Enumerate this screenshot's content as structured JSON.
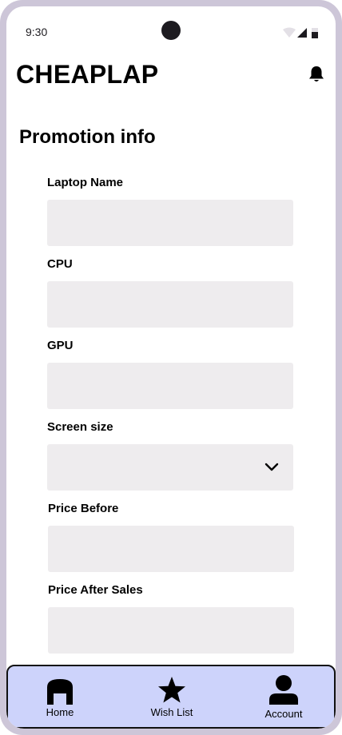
{
  "status_bar": {
    "time": "9:30"
  },
  "header": {
    "brand": "CHEAPLAP"
  },
  "page": {
    "title": "Promotion info"
  },
  "form": {
    "laptop_name_label": "Laptop Name",
    "cpu_label": "CPU",
    "gpu_label": "GPU",
    "screen_size_label": "Screen size",
    "price_before_label": "Price Before",
    "price_after_label": "Price After Sales"
  },
  "nav": {
    "items": [
      {
        "label": "Home",
        "icon": "home-icon"
      },
      {
        "label": "Wish List",
        "icon": "star-icon"
      },
      {
        "label": "Account",
        "icon": "account-icon"
      }
    ]
  },
  "colors": {
    "device_frame": "#cdc6d8",
    "field_background": "#eeecee",
    "nav_background": "#cdd3fb"
  }
}
